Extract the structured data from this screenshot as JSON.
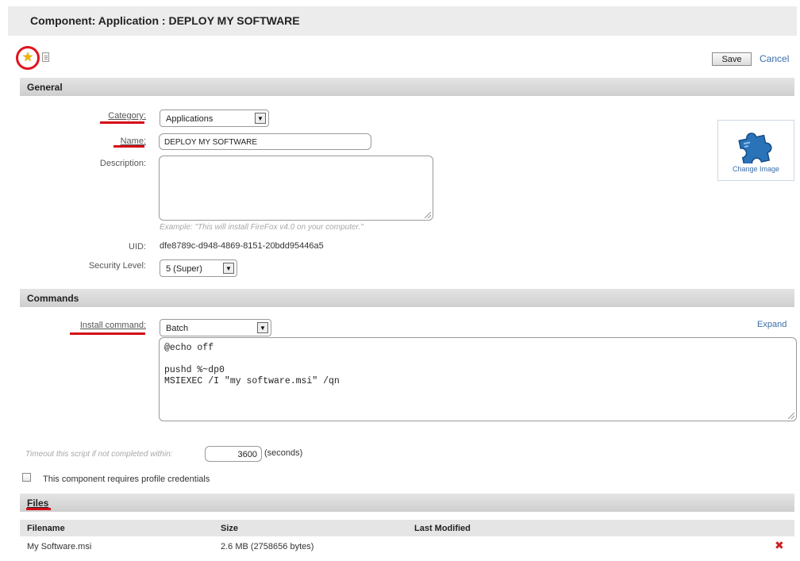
{
  "header": {
    "title": "Component: Application : DEPLOY MY SOFTWARE"
  },
  "toolbar": {
    "save_label": "Save",
    "cancel_label": "Cancel"
  },
  "general": {
    "section_title": "General",
    "category_label": "Category:",
    "category_value": "Applications",
    "name_label": "Name:",
    "name_value": "DEPLOY MY SOFTWARE",
    "description_label": "Description:",
    "description_value": "",
    "description_hint": "Example: \"This will install FireFox v4.0 on your computer.\"",
    "uid_label": "UID:",
    "uid_value": "dfe8789c-d948-4869-8151-20bdd95446a5",
    "security_label": "Security Level:",
    "security_value": "5 (Super)",
    "change_image_label": "Change Image",
    "image_icon": "puzzle-piece-icon"
  },
  "commands": {
    "section_title": "Commands",
    "install_label": "Install command:",
    "install_type": "Batch",
    "expand_label": "Expand",
    "script": "@echo off\n\npushd %~dp0\nMSIEXEC /I \"my software.msi\" /qn",
    "timeout_label": "Timeout this script if not completed within:",
    "timeout_value": "3600",
    "timeout_unit": "(seconds)",
    "credentials_label": "This component requires profile credentials",
    "credentials_checked": false
  },
  "files": {
    "section_title": "Files",
    "columns": [
      "Filename",
      "Size",
      "Last Modified"
    ],
    "rows": [
      {
        "filename": "My Software.msi",
        "size": "2.6 MB (2758656 bytes)",
        "last_modified": ""
      }
    ]
  },
  "colors": {
    "accent_link": "#3a6ea8",
    "highlight_red": "#d40c18",
    "star": "#f1b400",
    "delete": "#d02020"
  }
}
